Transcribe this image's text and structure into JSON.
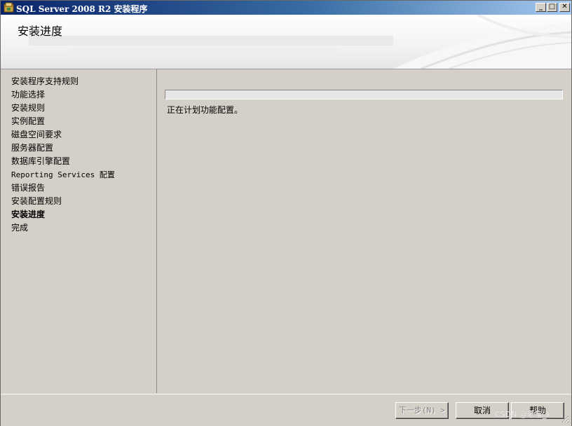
{
  "window": {
    "title": "SQL Server 2008 R2 安装程序",
    "controls": {
      "minimize": "_",
      "maximize": "□",
      "close": "✕"
    }
  },
  "header": {
    "page_title": "安装进度"
  },
  "sidebar": {
    "steps": [
      "安装程序支持规则",
      "功能选择",
      "安装规则",
      "实例配置",
      "磁盘空间要求",
      "服务器配置",
      "数据库引擎配置",
      "Reporting Services 配置",
      "错误报告",
      "安装配置规则",
      "安装进度",
      "完成"
    ],
    "current_step": "安装进度"
  },
  "main": {
    "progress": 0,
    "status_text": "正在计划功能配置。"
  },
  "footer": {
    "next_label": "下一步(N) >",
    "cancel_label": "取消",
    "help_label": "帮助"
  },
  "watermark": "CSDN @老宝_k",
  "colors": {
    "titlebar_start": "#0a246a",
    "titlebar_end": "#a6caf0",
    "dialog_bg": "#d4d0c8"
  },
  "icons": {
    "app": "sql-server-setup-icon",
    "grip": "resize-grip-icon"
  }
}
